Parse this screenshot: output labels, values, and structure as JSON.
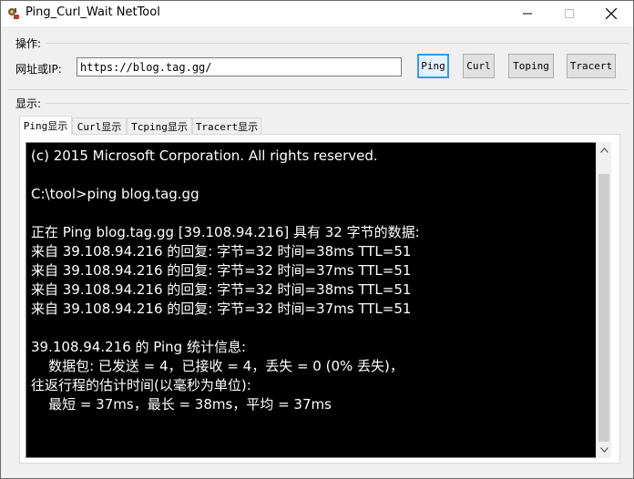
{
  "window": {
    "title": "Ping_Curl_Wait NetTool",
    "controls": {
      "minimize": "─",
      "maximize": "☐",
      "close": "✕"
    }
  },
  "operations": {
    "label": "操作:",
    "url_label": "网址或IP:",
    "url_value": "https://blog.tag.gg/",
    "buttons": {
      "ping": "Ping",
      "curl": "Curl",
      "toping": "Toping",
      "tracert": "Tracert"
    }
  },
  "display": {
    "label": "显示:",
    "tabs": [
      "Ping显示",
      "Curl显示",
      "Tcping显示",
      "Tracert显示"
    ],
    "active_tab": 0,
    "console_text": "(c) 2015 Microsoft Corporation. All rights reserved.\n\nC:\\tool>ping blog.tag.gg\n\n正在 Ping blog.tag.gg [39.108.94.216] 具有 32 字节的数据:\n来自 39.108.94.216 的回复: 字节=32 时间=38ms TTL=51\n来自 39.108.94.216 的回复: 字节=32 时间=37ms TTL=51\n来自 39.108.94.216 的回复: 字节=32 时间=38ms TTL=51\n来自 39.108.94.216 的回复: 字节=32 时间=37ms TTL=51\n\n39.108.94.216 的 Ping 统计信息:\n    数据包: 已发送 = 4，已接收 = 4，丢失 = 0 (0% 丢失)，\n往返行程的估计时间(以毫秒为单位):\n    最短 = 37ms，最长 = 38ms，平均 = 37ms"
  },
  "colors": {
    "console_bg": "#000000",
    "console_fg": "#ffffff",
    "focus_border": "#3399ff"
  },
  "icons": {
    "app": "gear-tool-icon",
    "scroll_up": "chevron-up-icon",
    "scroll_down": "chevron-down-icon"
  }
}
